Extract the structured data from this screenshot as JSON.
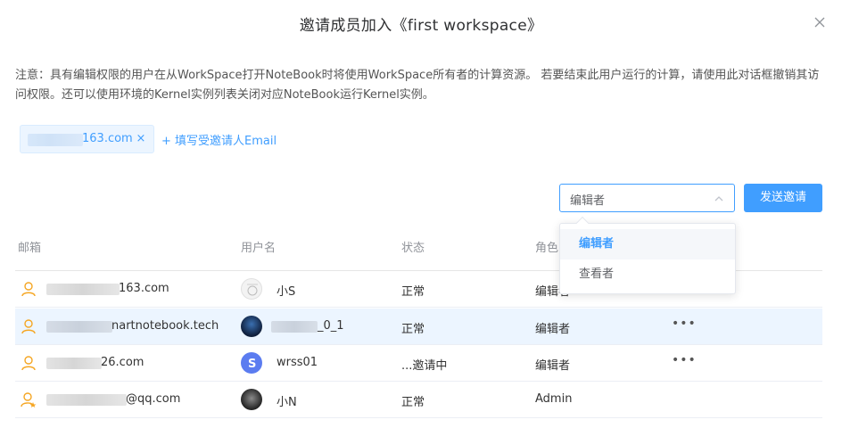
{
  "dialog": {
    "title": "邀请成员加入《first workspace》",
    "notice": "注意：具有编辑权限的用户在从WorkSpace打开NoteBook时将使用WorkSpace所有者的计算资源。 若要结束此用户运行的计算，请使用此对话框撤销其访问权限。还可以使用环境的Kernel实例列表关闭对应NoteBook运行Kernel实例。"
  },
  "invite": {
    "email_tag_suffix": "163.com",
    "tag_close": "×",
    "add_email_label": "+ 填写受邀请人Email",
    "role_value": "编辑者",
    "send_label": "发送邀请"
  },
  "role_dropdown": {
    "options": [
      "编辑者",
      "查看者"
    ],
    "selected": "编辑者"
  },
  "table": {
    "headers": {
      "email": "邮箱",
      "username": "用户名",
      "status": "状态",
      "role": "角色"
    },
    "rows": [
      {
        "email_visible": "163.com",
        "username": "小S",
        "status": "正常",
        "role": "编辑者",
        "more": ""
      },
      {
        "email_visible": "nartnotebook.tech",
        "username": "_0_1",
        "status": "正常",
        "role": "编辑者",
        "more": "•••"
      },
      {
        "email_visible": "26.com",
        "username": "wrss01",
        "status": "...邀请中",
        "role": "编辑者",
        "more": "•••"
      },
      {
        "email_visible": "@qq.com",
        "username": "小N",
        "status": "正常",
        "role": "Admin",
        "more": ""
      }
    ]
  },
  "colors": {
    "accent": "#409eff",
    "user_icon": "#f5a623",
    "highlight_row": "#ecf5ff"
  }
}
